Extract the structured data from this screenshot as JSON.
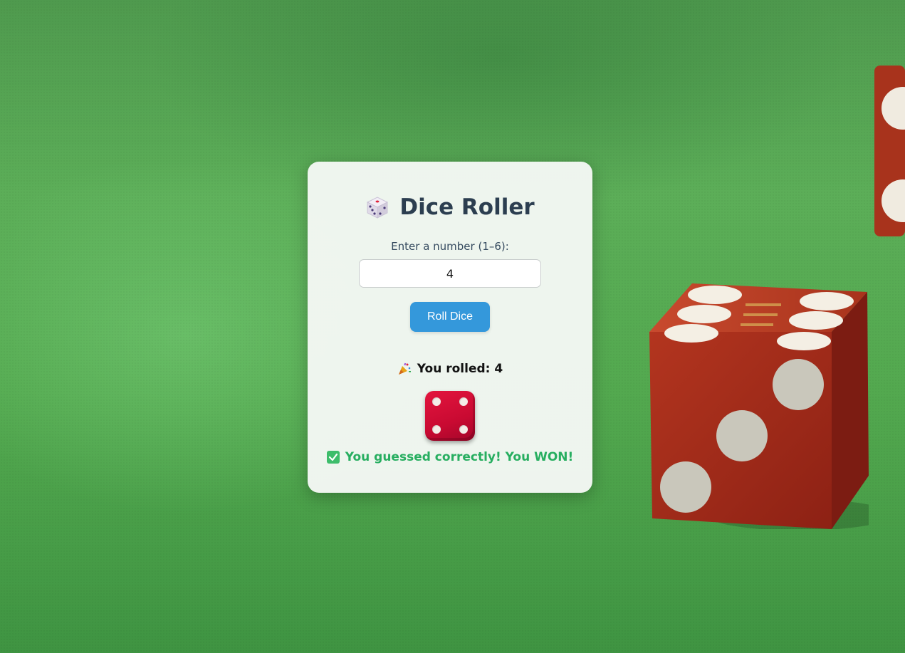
{
  "app": {
    "title": "Dice Roller",
    "title_icon": "game-die-icon"
  },
  "form": {
    "label": "Enter a number (1–6):",
    "input_value": "4",
    "roll_button_label": "Roll Dice"
  },
  "result": {
    "icon": "party-popper-icon",
    "text": "You rolled: 4",
    "rolled_value": 4,
    "message_icon": "check-mark-icon",
    "message": "You guessed correctly! You WON!",
    "message_color": "#27ae60"
  },
  "colors": {
    "button": "#3498db",
    "title": "#2c3e50",
    "die_face": "#d4103a",
    "background": "#53a94f"
  }
}
